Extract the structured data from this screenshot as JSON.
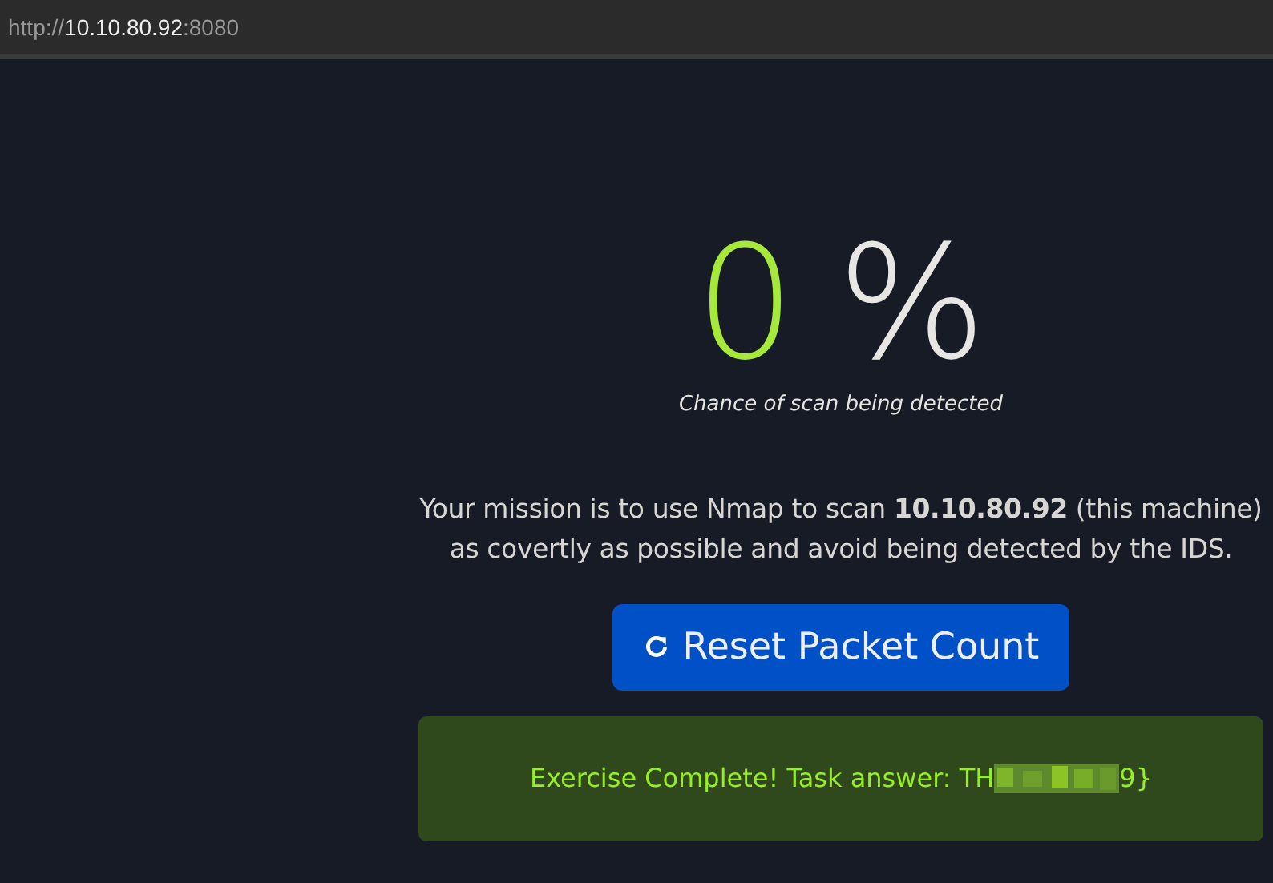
{
  "address_bar": {
    "scheme": "http://",
    "host": "10.10.80.92",
    "port": ":8080"
  },
  "detection": {
    "value": "0",
    "unit": "%",
    "caption": "Chance of scan being detected"
  },
  "mission": "Your mission is to use Nmap to scan **10.10.80.92** (this machine) as covertly as possible and avoid being detected by the IDS.",
  "reset_button": {
    "label": "Reset Packet Count"
  },
  "result_alert": {
    "text_before": "Exercise Complete! Task answer: TH",
    "text_after": "9}"
  }
}
